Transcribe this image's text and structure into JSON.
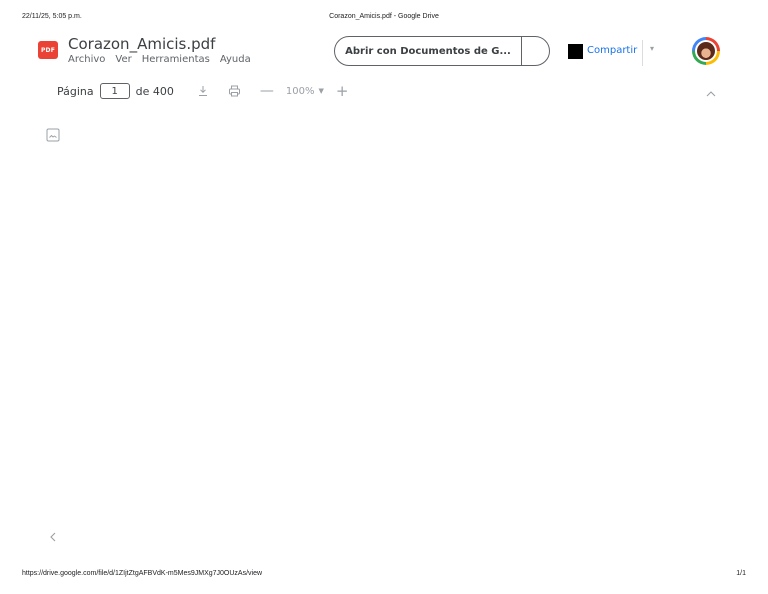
{
  "print_header": {
    "date": "22/11/25, 5:05 p.m.",
    "title": "Corazon_Amicis.pdf - Google Drive"
  },
  "file": {
    "badge": "PDF",
    "name": "Corazon_Amicis.pdf"
  },
  "menu": [
    {
      "label": "Archivo"
    },
    {
      "label": "Ver"
    },
    {
      "label": "Herramientas"
    },
    {
      "label": "Ayuda"
    }
  ],
  "open_with": {
    "label": "Abrir con Documentos de G..."
  },
  "share": {
    "label": "Compartir"
  },
  "toolbar": {
    "page_label": "Página",
    "current_page": "1",
    "page_total": "de 400",
    "zoom_minus": "—",
    "zoom": "100%",
    "zoom_plus": "+"
  },
  "icons": {
    "pdf": "pdf-file-icon",
    "download": "download-icon",
    "print": "print-icon",
    "zoom_dropdown": "caret-down-icon",
    "collapse": "chevron-up-icon",
    "thumbnail": "image-icon",
    "previous": "chevron-left-icon"
  },
  "colors": {
    "pdf_badge": "#ea4335",
    "share_text": "#1a73e8",
    "text": "#3c4043"
  },
  "print_footer": {
    "url": "https://drive.google.com/file/d/1ZIjtZtgAFBVdK-m5Mes9JMXg7J0OUzAs/view",
    "pages": "1/1"
  }
}
